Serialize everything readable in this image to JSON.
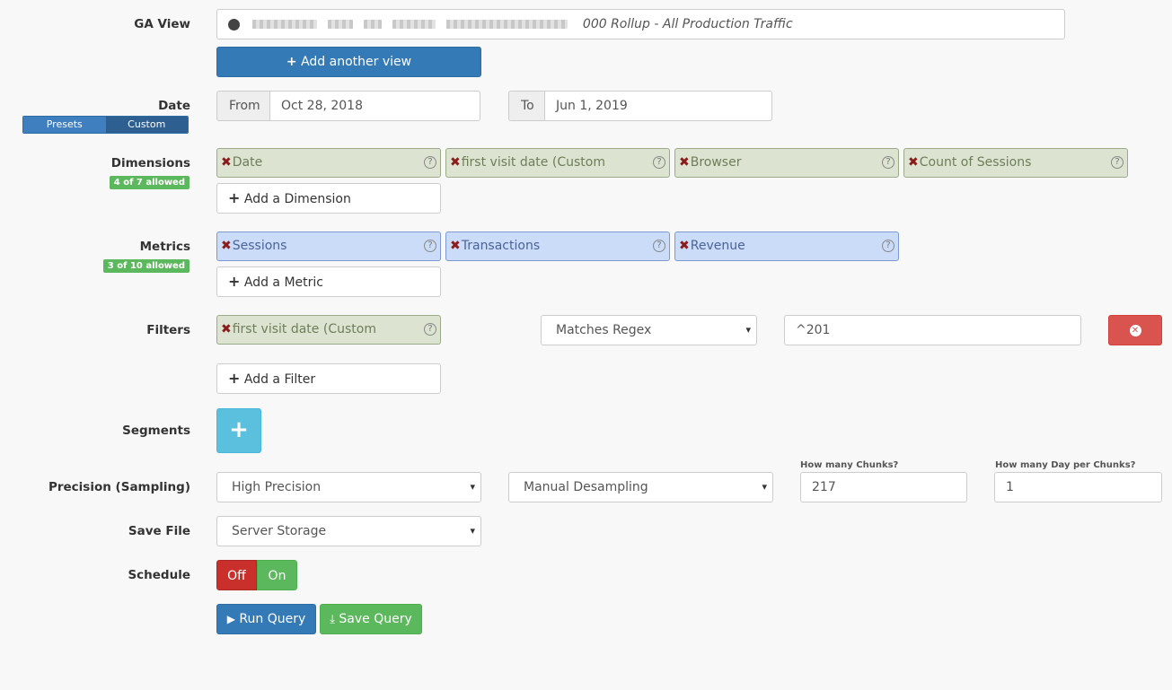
{
  "labels": {
    "ga_view": "GA View",
    "date": "Date",
    "dimensions": "Dimensions",
    "metrics": "Metrics",
    "filters": "Filters",
    "segments": "Segments",
    "precision": "Precision (Sampling)",
    "save_file": "Save File",
    "schedule": "Schedule"
  },
  "ga_view": {
    "value": "000 Rollup - All Production Traffic",
    "add_view_label": "Add another view"
  },
  "date": {
    "presets_label": "Presets",
    "custom_label": "Custom",
    "from_label": "From",
    "from_value": "Oct 28, 2018",
    "to_label": "To",
    "to_value": "Jun 1, 2019"
  },
  "dimensions": {
    "badge": "4 of 7 allowed",
    "items": [
      "Date",
      "first visit date (Custom",
      "Browser",
      "Count of Sessions"
    ],
    "add_label": "Add a Dimension"
  },
  "metrics": {
    "badge": "3 of 10 allowed",
    "items": [
      "Sessions",
      "Transactions",
      "Revenue"
    ],
    "add_label": "Add a Metric"
  },
  "filters": {
    "dimension": "first visit date (Custom",
    "operator": "Matches Regex",
    "value": "^201",
    "add_label": "Add a Filter"
  },
  "precision": {
    "mode": "High Precision",
    "desampling": "Manual Desampling",
    "chunks_label": "How many Chunks?",
    "chunks_value": "217",
    "days_label": "How many Day per Chunks?",
    "days_value": "1"
  },
  "save_file": {
    "value": "Server Storage"
  },
  "schedule": {
    "off_label": "Off",
    "on_label": "On"
  },
  "actions": {
    "run_label": "Run Query",
    "save_label": "Save Query"
  },
  "colors": {
    "primary": "#337ab7",
    "success": "#5cb85c",
    "danger": "#d9534f",
    "info": "#5bc0de",
    "dimension_chip": "#dce4d1",
    "metric_chip": "#cbdcf8"
  }
}
